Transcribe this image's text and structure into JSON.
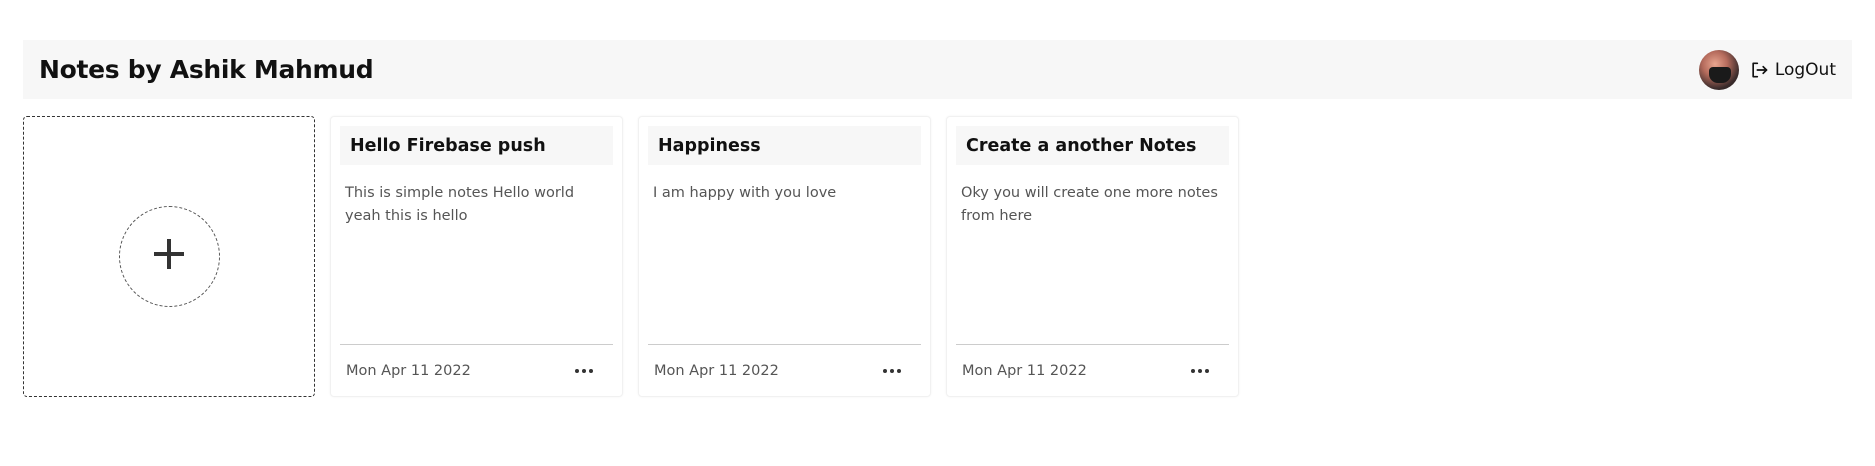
{
  "header": {
    "title": "Notes by Ashik Mahmud",
    "logout_label": "LogOut",
    "avatar_icon": "avatar"
  },
  "add_card": {
    "icon": "plus-icon"
  },
  "notes": [
    {
      "title": "Hello Firebase push",
      "body": "This is simple notes Hello world yeah this is hello",
      "date": "Mon Apr 11 2022"
    },
    {
      "title": "Happiness",
      "body": "I am happy with you love",
      "date": "Mon Apr 11 2022"
    },
    {
      "title": "Create a another Notes",
      "body": "Oky you will create one more notes from here",
      "date": "Mon Apr 11 2022"
    }
  ],
  "colors": {
    "header_bg": "#f7f7f7",
    "text_dark": "#111111",
    "text_muted": "#555555"
  }
}
